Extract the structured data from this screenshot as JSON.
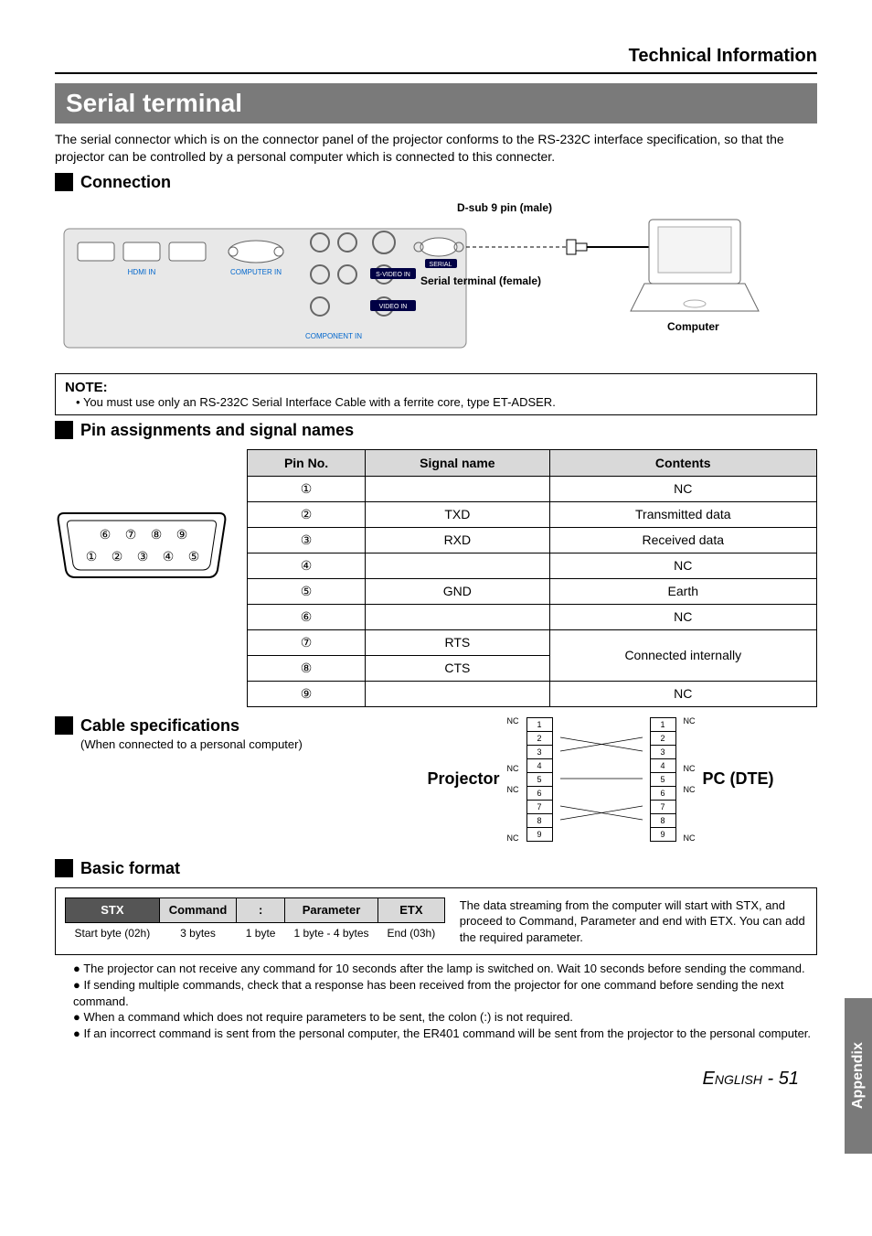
{
  "header": {
    "section_title": "Technical Information"
  },
  "title_bar": "Serial terminal",
  "intro": "The serial connector which is on the connector panel of the projector conforms to the RS-232C interface specification, so that the projector can be controlled by a personal computer which is connected to this connecter.",
  "connection": {
    "heading": "Connection",
    "labels": {
      "dsub": "D-sub 9 pin (male)",
      "serial_terminal": "Serial terminal (female)",
      "computer": "Computer",
      "port_hdmi": "HDMI IN",
      "port_computer": "COMPUTER IN",
      "port_serial": "SERIAL",
      "port_svideo": "S-VIDEO IN",
      "port_video": "VIDEO IN",
      "port_component": "COMPONENT IN"
    }
  },
  "note": {
    "title": "NOTE:",
    "text": "You must use only an RS-232C Serial Interface Cable with a ferrite core, type ET-ADSER."
  },
  "pin_section": {
    "heading": "Pin assignments and signal names",
    "columns": {
      "pin": "Pin No.",
      "signal": "Signal name",
      "contents": "Contents"
    },
    "rows": [
      {
        "pin": "①",
        "signal": "",
        "contents": "NC"
      },
      {
        "pin": "②",
        "signal": "TXD",
        "contents": "Transmitted data"
      },
      {
        "pin": "③",
        "signal": "RXD",
        "contents": "Received data"
      },
      {
        "pin": "④",
        "signal": "",
        "contents": "NC"
      },
      {
        "pin": "⑤",
        "signal": "GND",
        "contents": "Earth"
      },
      {
        "pin": "⑥",
        "signal": "",
        "contents": "NC"
      },
      {
        "pin": "⑦",
        "signal": "RTS",
        "contents": "Connected internally"
      },
      {
        "pin": "⑧",
        "signal": "CTS",
        "contents": "Connected internally"
      },
      {
        "pin": "⑨",
        "signal": "",
        "contents": "NC"
      }
    ],
    "diagram_pins_top": [
      "⑥",
      "⑦",
      "⑧",
      "⑨"
    ],
    "diagram_pins_bottom": [
      "①",
      "②",
      "③",
      "④",
      "⑤"
    ]
  },
  "cable_section": {
    "heading": "Cable specifications",
    "subtext": "(When connected to a personal computer)",
    "left_label": "Projector",
    "right_label": "PC (DTE)",
    "nc": "NC",
    "pins": [
      "1",
      "2",
      "3",
      "4",
      "5",
      "6",
      "7",
      "8",
      "9"
    ]
  },
  "format_section": {
    "heading": "Basic format",
    "cols": {
      "stx": "STX",
      "command": "Command",
      "colon": ":",
      "parameter": "Parameter",
      "etx": "ETX"
    },
    "vals": {
      "stx": "Start byte (02h)",
      "command": "3 bytes",
      "colon": "1 byte",
      "parameter": "1 byte - 4 bytes",
      "etx": "End (03h)"
    },
    "desc": "The data streaming from the computer will start with STX, and proceed to Command, Parameter and end with ETX. You can add the required parameter.",
    "bullets": [
      "The projector can not receive any command for 10 seconds after the lamp is switched on. Wait 10 seconds before sending the command.",
      "If sending multiple commands, check that a response has been received from the projector for one command before sending the next command.",
      "When a command which does not require parameters to be sent, the colon (:) is not required.",
      "If an incorrect command is sent from the personal computer, the ER401 command will be sent from the projector to the personal computer."
    ]
  },
  "footer": {
    "appendix": "Appendix",
    "page": "English - 51"
  }
}
